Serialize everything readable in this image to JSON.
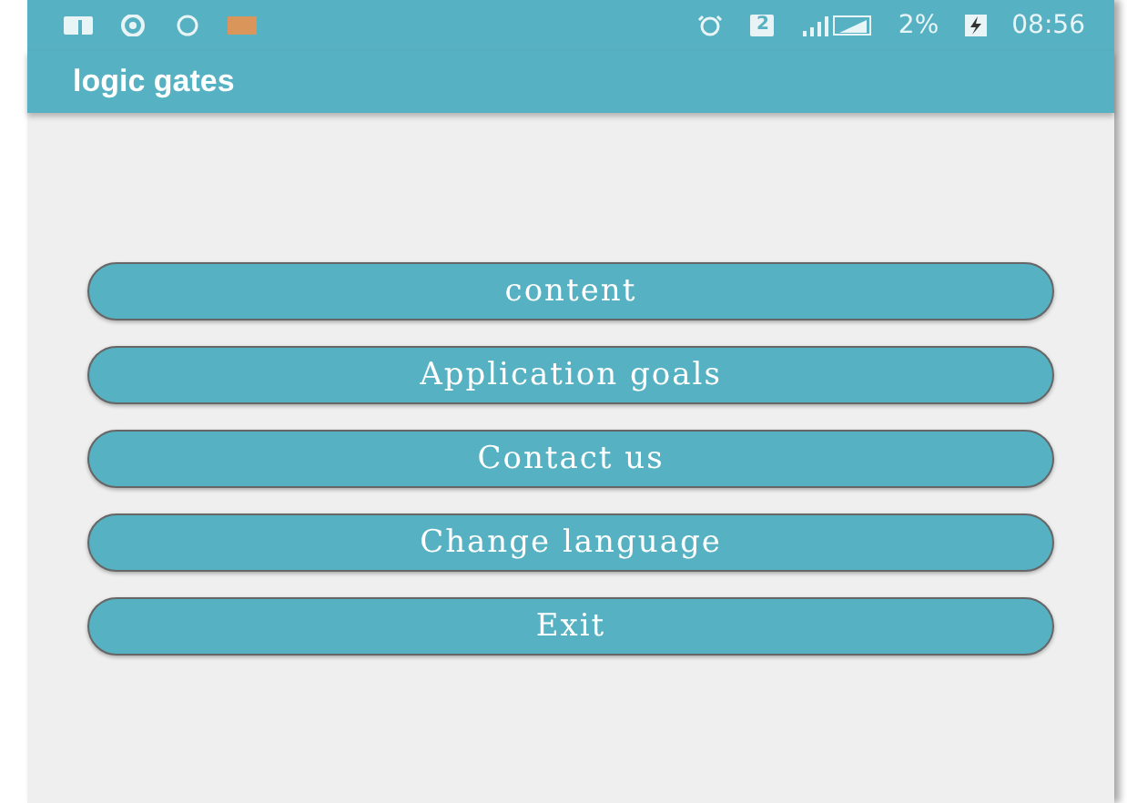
{
  "status_bar": {
    "sim": "2",
    "battery": "2%",
    "time": "08:56"
  },
  "app_bar": {
    "title": "logic gates"
  },
  "buttons": [
    "content",
    "Application goals",
    "Contact us",
    "Change language",
    "Exit"
  ]
}
